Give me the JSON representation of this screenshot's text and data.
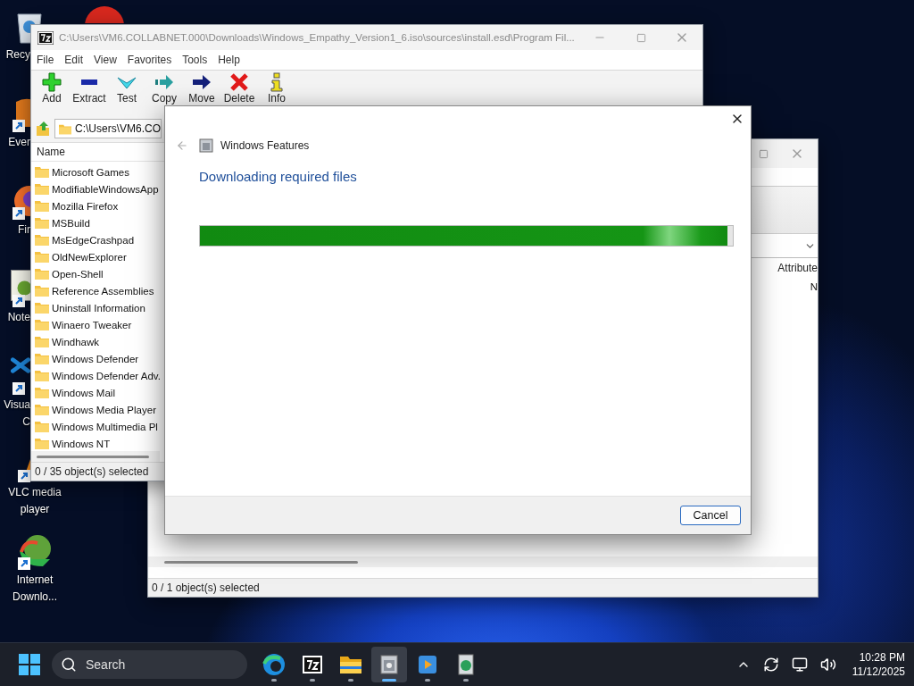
{
  "desktop_icons": [
    {
      "kind": "recycle-bin",
      "lines": [
        "Recy"
      ],
      "clipped": true,
      "shortcut": false
    },
    {
      "kind": "note-app",
      "lines": [
        "Ever"
      ],
      "clipped": true,
      "shortcut": true
    },
    {
      "kind": "browser",
      "lines": [
        "Fir"
      ],
      "clipped": true,
      "shortcut": true
    },
    {
      "kind": "notepad",
      "lines": [
        "Note"
      ],
      "clipped": true,
      "shortcut": true
    },
    {
      "kind": "code-editor",
      "lines": [
        "Visua",
        "C"
      ],
      "clipped": true,
      "shortcut": true
    },
    {
      "kind": "media-player",
      "lines": [
        "VLC media",
        "player"
      ],
      "clipped": false,
      "shortcut": true
    },
    {
      "kind": "download-manager",
      "lines": [
        "Internet",
        "Downlo..."
      ],
      "clipped": false,
      "shortcut": true
    }
  ],
  "explorer_window": {
    "column_header": "Attribute",
    "cell": "N",
    "status": "0 / 1 object(s) selected"
  },
  "archive_window": {
    "title": "C:\\Users\\VM6.COLLABNET.000\\Downloads\\Windows_Empathy_Version1_6.iso\\sources\\install.esd\\Program Fil...",
    "menu": [
      "File",
      "Edit",
      "View",
      "Favorites",
      "Tools",
      "Help"
    ],
    "toolbar": [
      {
        "kind": "add",
        "label": "Add"
      },
      {
        "kind": "extract",
        "label": "Extract"
      },
      {
        "kind": "test",
        "label": "Test"
      },
      {
        "kind": "copy",
        "label": "Copy"
      },
      {
        "kind": "move",
        "label": "Move"
      },
      {
        "kind": "delete",
        "label": "Delete"
      },
      {
        "kind": "info",
        "label": "Info"
      }
    ],
    "path": "C:\\Users\\VM6.CO",
    "column": "Name",
    "items": [
      "Microsoft Games",
      "ModifiableWindowsApp",
      "Mozilla Firefox",
      "MSBuild",
      "MsEdgeCrashpad",
      "OldNewExplorer",
      "Open-Shell",
      "Reference Assemblies",
      "Uninstall Information",
      "Winaero Tweaker",
      "Windhawk",
      "Windows Defender",
      "Windows Defender Adv.",
      "Windows Mail",
      "Windows Media Player",
      "Windows Multimedia Pl",
      "Windows NT"
    ],
    "status": "0 / 35 object(s) selected"
  },
  "dialog": {
    "title": "Windows Features",
    "heading": "Downloading required files",
    "progress": {
      "level": 0.99
    },
    "buttons": [
      "Cancel"
    ]
  },
  "taskbar": {
    "search": {
      "placeholder": "Search"
    },
    "apps": [
      {
        "kind": "browser",
        "selected": false
      },
      {
        "kind": "archiver",
        "selected": false
      },
      {
        "kind": "folder",
        "selected": false
      },
      {
        "kind": "installer",
        "selected": true
      },
      {
        "kind": "player",
        "selected": false
      },
      {
        "kind": "tool",
        "selected": false
      }
    ],
    "tray": [
      {
        "kind": "chevron"
      },
      {
        "kind": "sync"
      },
      {
        "kind": "network"
      },
      {
        "kind": "volume"
      }
    ],
    "time": "10:28 PM",
    "date": "11/12/2025"
  }
}
